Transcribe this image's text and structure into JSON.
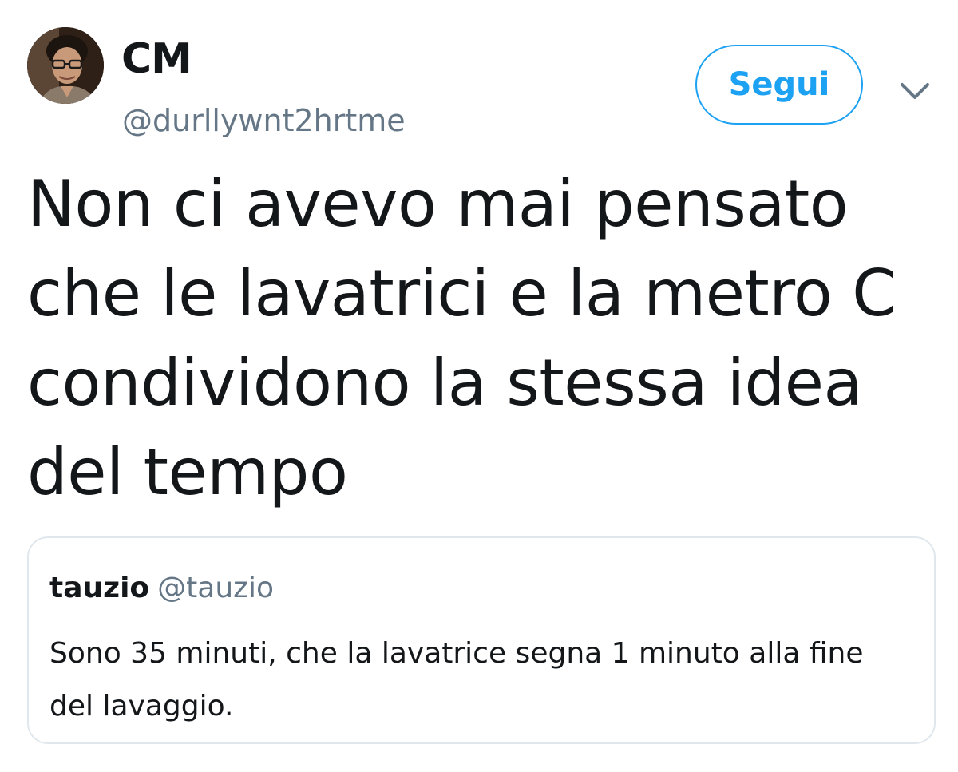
{
  "author": {
    "display_name": "CM",
    "handle": "@durllywnt2hrtme"
  },
  "actions": {
    "follow_label": "Segui"
  },
  "tweet": {
    "text": "Non ci avevo mai pensato\nche le lavatrici e la metro C\ncondividono la stessa idea\ndel tempo"
  },
  "quoted_tweet": {
    "display_name": "tauzio",
    "handle": "@tauzio",
    "text": "Sono 35 minuti, che la lavatrice segna 1 minuto alla fine del lavaggio."
  },
  "colors": {
    "accent": "#1da1f2",
    "text": "#14171a",
    "secondary_text": "#657786",
    "border": "#e1e8ed"
  },
  "icons": {
    "more": "chevron-down-icon",
    "avatar": "user-avatar"
  }
}
